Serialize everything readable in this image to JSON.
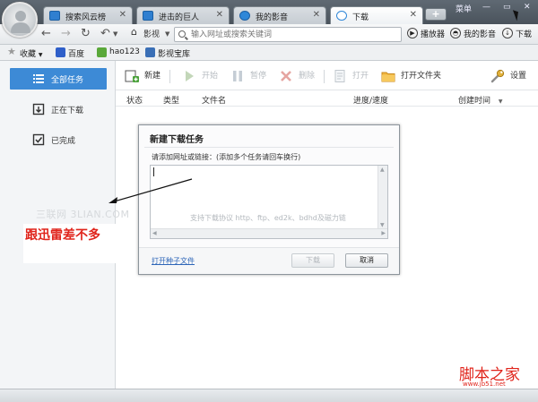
{
  "tabs": [
    {
      "label": "搜索风云榜",
      "icon": "page-icon"
    },
    {
      "label": "进击的巨人",
      "icon": "page-icon"
    },
    {
      "label": "我的影音",
      "icon": "media-icon"
    },
    {
      "label": "下载",
      "icon": "download-icon",
      "active": true
    }
  ],
  "window": {
    "menu_label": "菜单"
  },
  "nav": {
    "home_label": "影视",
    "address_placeholder": "输入网址或搜索关键词",
    "player_label": "播放器",
    "media_label": "我的影音",
    "download_label": "下载"
  },
  "bookmarks": {
    "favorites_label": "收藏",
    "items": [
      "百度",
      "hao123",
      "影视宝库"
    ]
  },
  "sidebar": {
    "items": [
      {
        "label": "全部任务",
        "icon": "list-icon",
        "active": true
      },
      {
        "label": "正在下载",
        "icon": "downloading-icon"
      },
      {
        "label": "已完成",
        "icon": "completed-icon"
      }
    ]
  },
  "toolbar": {
    "new_label": "新建",
    "start_label": "开始",
    "pause_label": "暂停",
    "delete_label": "删除",
    "open_label": "打开",
    "open_folder_label": "打开文件夹",
    "settings_label": "设置"
  },
  "table": {
    "columns": [
      "状态",
      "类型",
      "文件名",
      "进度/速度",
      "创建时间"
    ]
  },
  "dialog": {
    "title": "新建下载任务",
    "hint": "请添加网址或链接：(添加多个任务请回车换行)",
    "placeholder": "支持下载协议 http、ftp、ed2k、bdhd及磁力链",
    "torrent_link": "打开种子文件",
    "download_button": "下载",
    "cancel_button": "取消"
  },
  "annotation": {
    "watermark": "三联网 3LIAN.COM",
    "note": "跟迅雷差不多"
  },
  "brand": {
    "name": "脚本之家",
    "url": "www.jb51.net"
  },
  "colors": {
    "accent": "#3d8ad6",
    "annotation": "#e0241b"
  }
}
